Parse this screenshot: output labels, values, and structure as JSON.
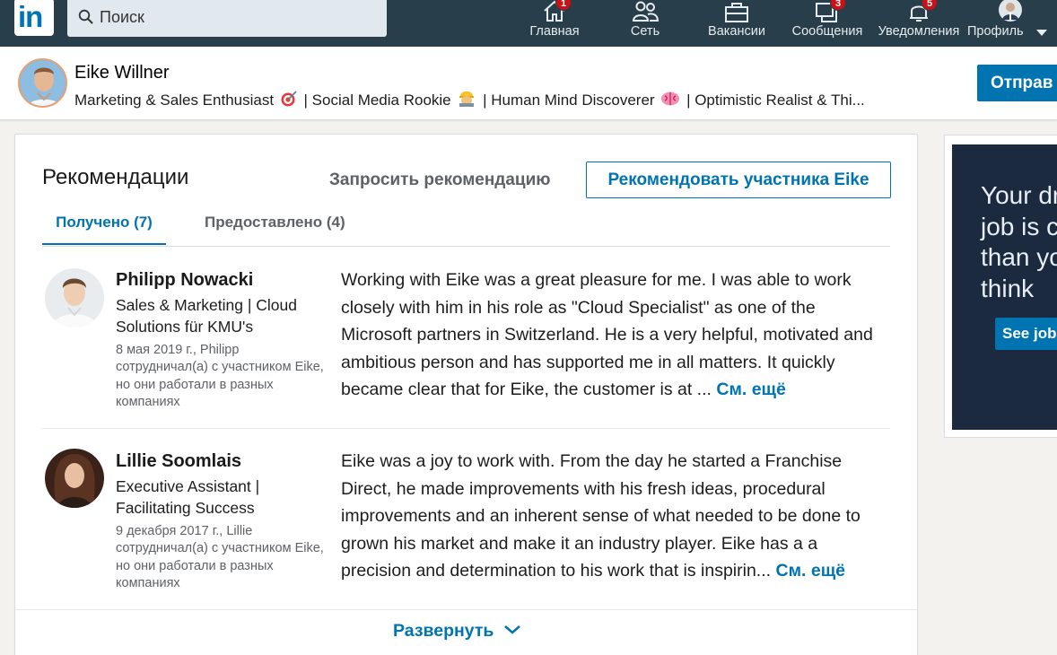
{
  "nav": {
    "search_placeholder": "Поиск",
    "items": [
      {
        "label": "Главная",
        "badge": "1",
        "icon": "home-icon"
      },
      {
        "label": "Сеть",
        "badge": "",
        "icon": "network-icon"
      },
      {
        "label": "Вакансии",
        "badge": "",
        "icon": "briefcase-icon"
      },
      {
        "label": "Сообщения",
        "badge": "3",
        "icon": "messaging-icon"
      },
      {
        "label": "Уведомления",
        "badge": "5",
        "icon": "bell-icon"
      },
      {
        "label": "Профиль",
        "badge": "",
        "icon": "profile-avatar-icon"
      }
    ],
    "colors": {
      "bar": "#283e4a",
      "badge": "#cc1016",
      "brand": "#0073b1"
    }
  },
  "profile": {
    "name": "Eike Willner",
    "headline_parts": [
      "Marketing & Sales Enthusiast",
      "| Social Media Rookie",
      "| Human Mind Discoverer",
      "| Optimistic Realist & Thi..."
    ],
    "send_button": "Отправ"
  },
  "recommendations": {
    "title": "Рекомендации",
    "request_link": "Запросить рекомендацию",
    "recommend_button": "Рекомендовать участника Eike",
    "tabs": [
      {
        "label": "Получено (7)",
        "active": true
      },
      {
        "label": "Предоставлено (4)",
        "active": false
      }
    ],
    "items": [
      {
        "name": "Philipp Nowacki",
        "headline": "Sales & Marketing | Cloud Solutions für KMU's",
        "meta": "8 мая 2019 г., Philipp сотрудничал(а) с участником Eike, но они работали в разных компаниях",
        "text": "Working with Eike was a great pleasure for me. I was able to work closely with him in his role as \"Cloud Specialist\" as one of the Microsoft partners in Switzerland. He is a very helpful, motivated and ambitious person and has supported me in all matters. It quickly became clear that for Eike, the customer is at ...",
        "see_more": "См. ещё"
      },
      {
        "name": "Lillie Soomlais",
        "headline": "Executive Assistant | Facilitating Success",
        "meta": "9 декабря 2017 г., Lillie сотрудничал(а) с участником Eike, но они работали в разных компаниях",
        "text": "Eike was a joy to work with. From the day he started a Franchise Direct, he made improvements with his fresh ideas, procedural improvements and an inherent sense of what needed to be done to grown his market and make it an industry player. Eike has a a precision and determination to his work that is inspirin...",
        "see_more": "См. ещё"
      }
    ],
    "expand_label": "Развернуть"
  },
  "ad": {
    "text_lines": [
      "Your dr",
      "job is c",
      "than yo",
      "think"
    ],
    "button": "See jobs"
  }
}
